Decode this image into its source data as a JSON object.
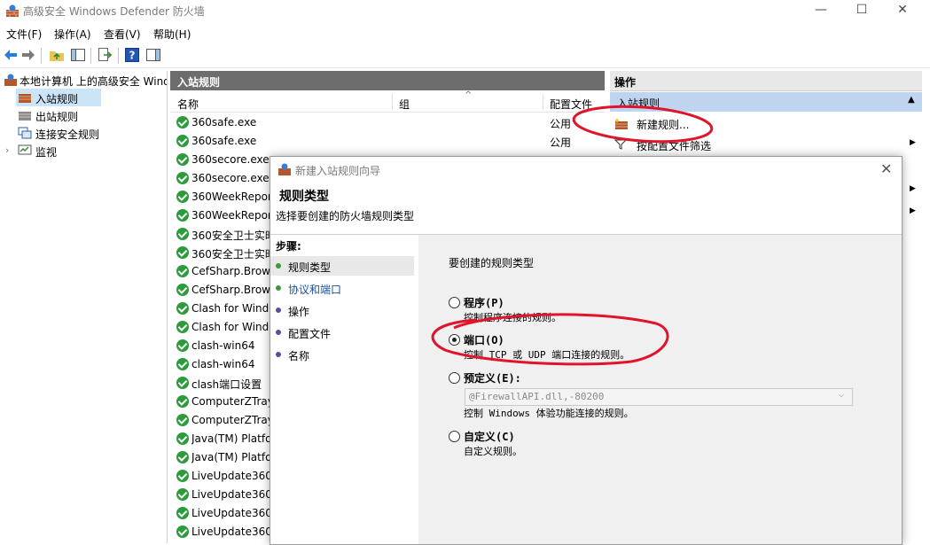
{
  "window": {
    "title": "高级安全 Windows Defender 防火墙",
    "minimize": "—",
    "maximize": "☐",
    "close": "✕"
  },
  "menu": [
    "文件(F)",
    "操作(A)",
    "查看(V)",
    "帮助(H)"
  ],
  "tree": {
    "root": "本地计算机 上的高级安全 Windows",
    "items": [
      "入站规则",
      "出站规则",
      "连接安全规则",
      "监视"
    ]
  },
  "list": {
    "header": "入站规则",
    "columns": [
      "名称",
      "组",
      "配置文件"
    ],
    "rows": [
      {
        "name": "360safe.exe",
        "profile": "公用"
      },
      {
        "name": "360safe.exe",
        "profile": "公用"
      },
      {
        "name": "360secore.exe",
        "profile": ""
      },
      {
        "name": "360secore.exe",
        "profile": ""
      },
      {
        "name": "360WeekReport",
        "profile": ""
      },
      {
        "name": "360WeekReport",
        "profile": ""
      },
      {
        "name": "360安全卫士实时保护",
        "profile": ""
      },
      {
        "name": "360安全卫士实时保护",
        "profile": ""
      },
      {
        "name": "CefSharp.BrowserSubprocess",
        "profile": ""
      },
      {
        "name": "CefSharp.BrowserSubprocess",
        "profile": ""
      },
      {
        "name": "Clash for Windows",
        "profile": ""
      },
      {
        "name": "Clash for Windows",
        "profile": ""
      },
      {
        "name": "clash-win64",
        "profile": ""
      },
      {
        "name": "clash-win64",
        "profile": ""
      },
      {
        "name": "clash端口设置",
        "profile": ""
      },
      {
        "name": "ComputerZTray",
        "profile": ""
      },
      {
        "name": "ComputerZTray",
        "profile": ""
      },
      {
        "name": "Java(TM) Platform",
        "profile": ""
      },
      {
        "name": "Java(TM) Platform",
        "profile": ""
      },
      {
        "name": "LiveUpdate360",
        "profile": ""
      },
      {
        "name": "LiveUpdate360",
        "profile": ""
      },
      {
        "name": "LiveUpdate360",
        "profile": ""
      },
      {
        "name": "LiveUpdate360",
        "profile": ""
      }
    ]
  },
  "actions": {
    "header": "操作",
    "section": "入站规则",
    "items": [
      "新建规则...",
      "按配置文件筛选"
    ]
  },
  "dialog": {
    "title": "新建入站规则向导",
    "heading": "规则类型",
    "subheading": "选择要创建的防火墙规则类型",
    "steps_label": "步骤:",
    "steps": [
      "规则类型",
      "协议和端口",
      "操作",
      "配置文件",
      "名称"
    ],
    "prompt": "要创建的规则类型",
    "options": [
      {
        "label": "程序(P)",
        "desc": "控制程序连接的规则。"
      },
      {
        "label": "端口(O)",
        "desc": "控制 TCP 或 UDP 端口连接的规则。"
      },
      {
        "label": "预定义(E):",
        "desc": "控制 Windows 体验功能连接的规则。"
      },
      {
        "label": "自定义(C)",
        "desc": "自定义规则。"
      }
    ],
    "predefined_value": "@FirewallAPI.dll,-80200",
    "close": "✕"
  },
  "colors": {
    "step_active": "#3c9a3c",
    "step_inactive": "#5050a0",
    "link": "#1a4f9c",
    "annotation": "#e0142a"
  }
}
